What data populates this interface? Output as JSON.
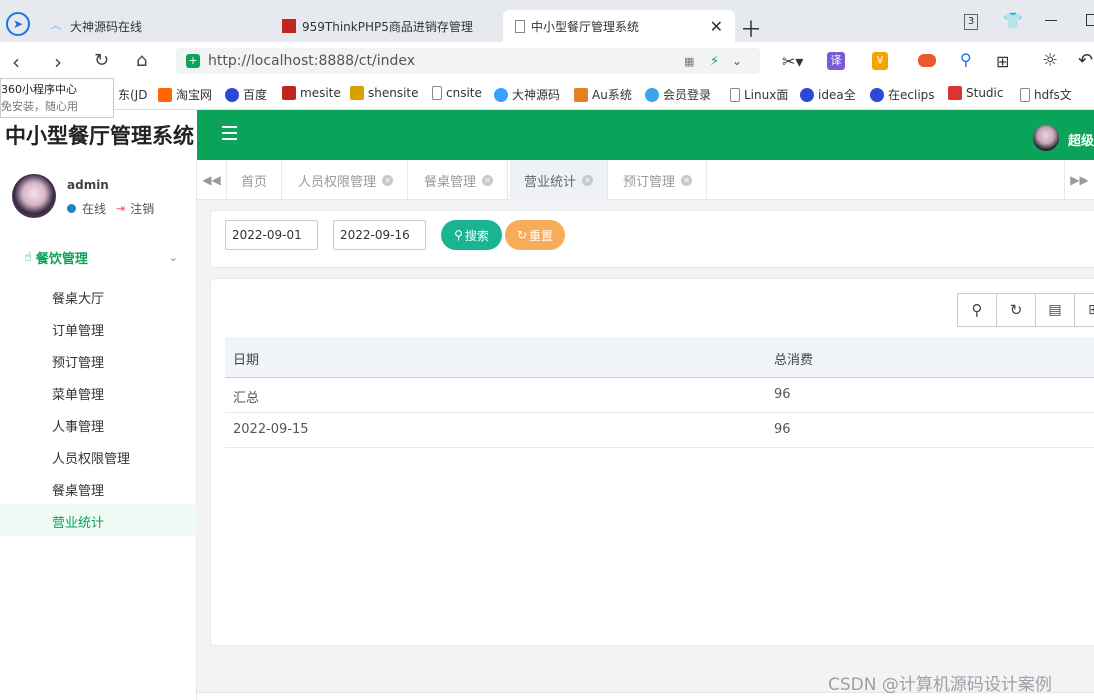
{
  "browser": {
    "tabs": [
      {
        "title": "大神源码在线"
      },
      {
        "title": "959ThinkPHP5商品进销存管理"
      },
      {
        "title": "中小型餐厅管理系统"
      }
    ],
    "window_badge": "3",
    "url": "http://localhost:8888/ct/index",
    "bookmarks": [
      "东(JD",
      "淘宝网",
      "百度",
      "mesite",
      "shensite",
      "cnsite",
      "大神源码",
      "Au系统",
      "会员登录",
      "Linux面",
      "idea全",
      "在eclips",
      "Studic",
      "hdfs文"
    ],
    "popup": {
      "line1": "360小程序中心",
      "line2": "免安装，随心用"
    }
  },
  "app": {
    "brand": "中小型餐厅管理系统",
    "user": {
      "name": "admin",
      "status": "在线",
      "logout": "注销",
      "top_name": "超级"
    },
    "menu_group": "餐饮管理",
    "menu": [
      "餐桌大厅",
      "订单管理",
      "预订管理",
      "菜单管理",
      "人事管理",
      "人员权限管理",
      "餐桌管理",
      "营业统计"
    ],
    "active_menu": "营业统计",
    "page_tabs": [
      {
        "label": "首页"
      },
      {
        "label": "人员权限管理"
      },
      {
        "label": "餐桌管理"
      },
      {
        "label": "营业统计"
      },
      {
        "label": "预订管理"
      }
    ],
    "search": {
      "start_date": "2022-09-01",
      "end_date": "2022-09-16",
      "search_label": "搜索",
      "reset_label": "重置"
    },
    "table": {
      "headers": [
        "日期",
        "总消费"
      ],
      "rows": [
        [
          "汇总",
          "96"
        ],
        [
          "2022-09-15",
          "96"
        ]
      ]
    },
    "watermark": "CSDN @计算机源码设计案例"
  },
  "colors": {
    "green": "#0ba259",
    "teal": "#1ab394",
    "orange": "#f8ac59",
    "active_menu_bg": "#f0faf4"
  }
}
